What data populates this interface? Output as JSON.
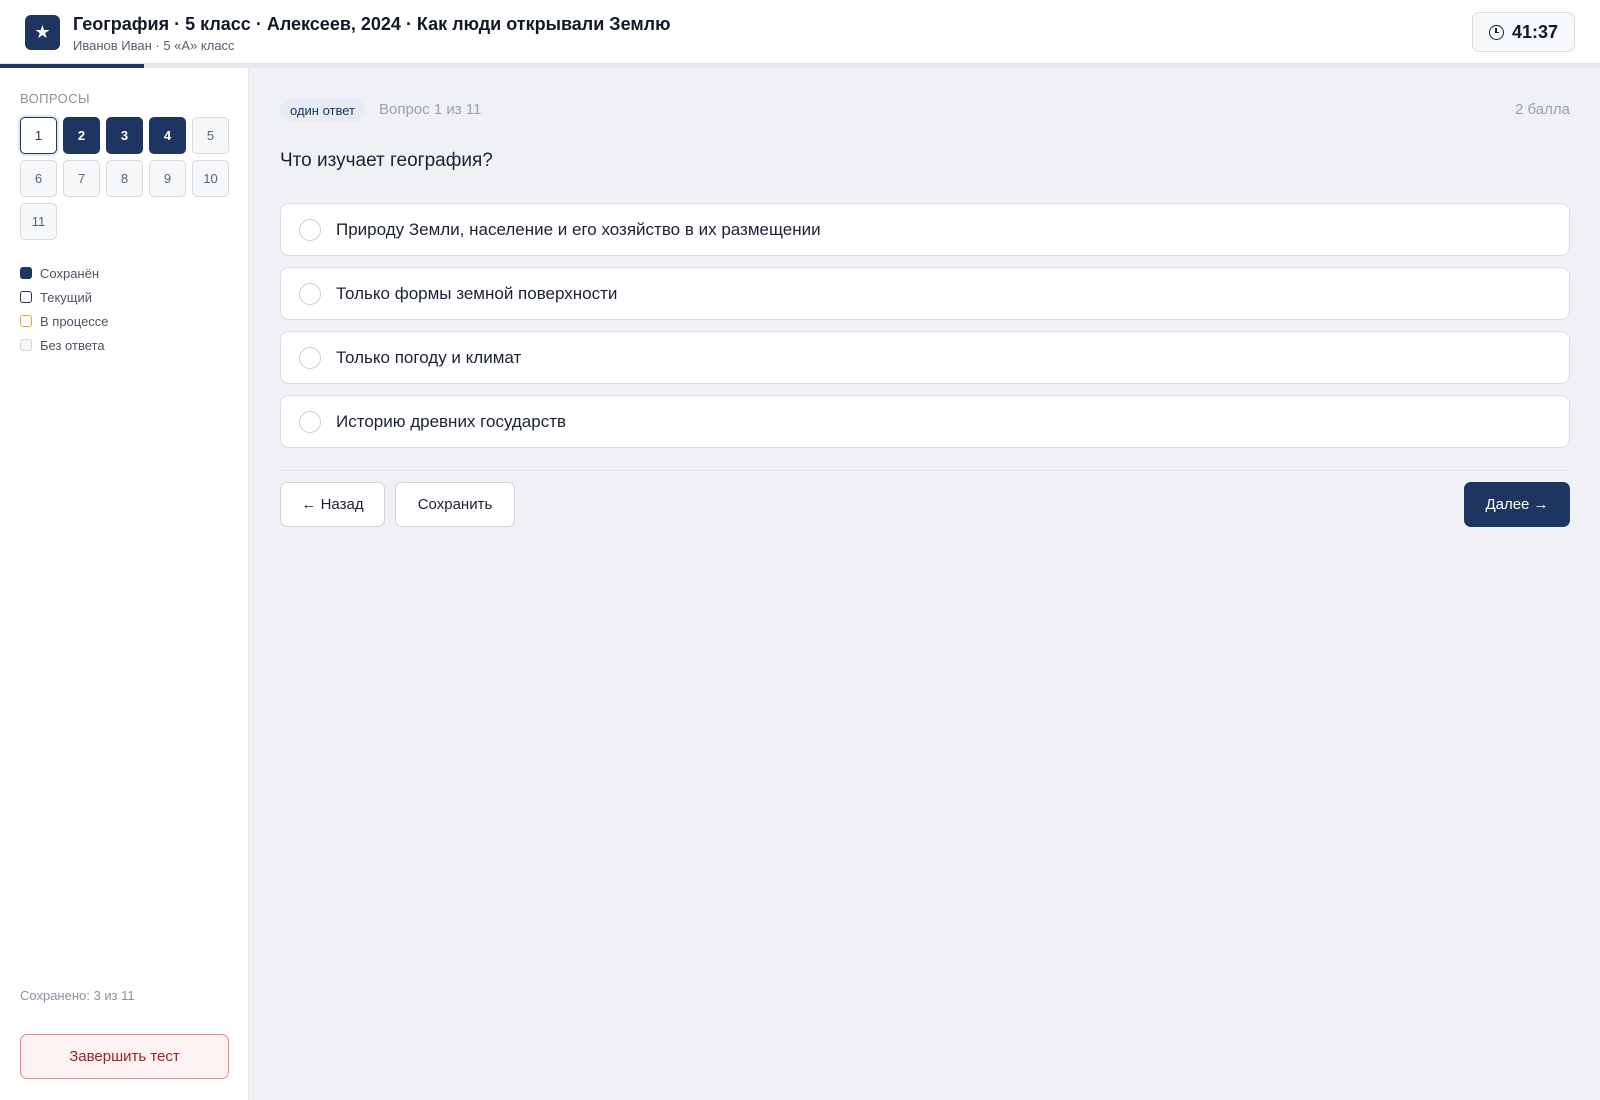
{
  "header": {
    "logo_glyph": "★",
    "title": "География · 5 класс · Алексеев, 2024 · Как люди открывали Землю",
    "subtitle": "Иванов Иван · 5 «А» класс",
    "timer": "41:37"
  },
  "progress": {
    "completed_fraction": 0.09
  },
  "sidebar": {
    "heading": "ВОПРОСЫ",
    "questions": [
      {
        "label": "1",
        "state": "current"
      },
      {
        "label": "2",
        "state": "saved"
      },
      {
        "label": "3",
        "state": "saved"
      },
      {
        "label": "4",
        "state": "saved"
      },
      {
        "label": "5",
        "state": "empty"
      },
      {
        "label": "6",
        "state": "empty"
      },
      {
        "label": "7",
        "state": "empty"
      },
      {
        "label": "8",
        "state": "empty"
      },
      {
        "label": "9",
        "state": "empty"
      },
      {
        "label": "10",
        "state": "empty"
      },
      {
        "label": "11",
        "state": "empty"
      }
    ],
    "legend": {
      "saved": "Сохранён",
      "current": "Текущий",
      "in_progress": "В процессе",
      "no_answer": "Без ответа"
    },
    "saved_count": "Сохранено: 3 из 11",
    "finish_label": "Завершить тест"
  },
  "question": {
    "badge": "один ответ",
    "number": "Вопрос 1 из 11",
    "points": "2 балла",
    "text": "Что изучает география?",
    "options": [
      "Природу Земли, население и его хозяйство в их размещении",
      "Только формы земной поверхности",
      "Только погоду и климат",
      "Историю древних государств"
    ]
  },
  "actions": {
    "back": "← Назад",
    "save": "Сохранить",
    "next": "Далее →"
  },
  "colors": {
    "accent": "#1e3461",
    "in_progress": "#e3a52b",
    "danger": "#9c2323"
  }
}
